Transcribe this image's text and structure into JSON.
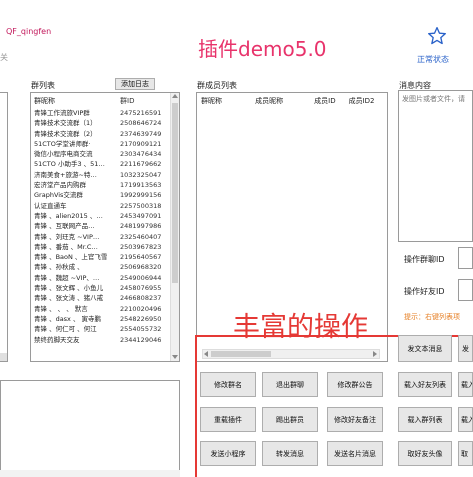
{
  "header": {
    "user_name": "QF_qingfen",
    "user_sub": "关",
    "title": "插件demo5.0",
    "status_label": "正常状态"
  },
  "groups": {
    "label": "群列表",
    "add_log_button": "添加日志",
    "col_name": "群昵称",
    "col_id": "群ID",
    "rows": [
      {
        "name": "青锋工作流旅VIP群",
        "id": "2475216591"
      },
      {
        "name": "青锋技术交流群（1）",
        "id": "2508646724"
      },
      {
        "name": "青锋技术交流群（2）",
        "id": "2374639749"
      },
      {
        "name": "51CTO学堂讲师群·",
        "id": "2170909121"
      },
      {
        "name": "微信小程序电商交流",
        "id": "2303476434"
      },
      {
        "name": "51CTO 小助手3 、51…",
        "id": "2211679662"
      },
      {
        "name": "济南美食+旅游~特…",
        "id": "1032325047"
      },
      {
        "name": "宏济堂产品内购群",
        "id": "1719913563"
      },
      {
        "name": "GraphVis交流群",
        "id": "1992999156"
      },
      {
        "name": "认证直通车",
        "id": "2257500318"
      },
      {
        "name": "青锋 、alien2015 、…",
        "id": "2453497091"
      },
      {
        "name": "青锋 、互联网产品…",
        "id": "2481997986"
      },
      {
        "name": "青锋 、刘玨克 ~VIP…",
        "id": "2325460407"
      },
      {
        "name": "青锋 、番茄 、Mr.C…",
        "id": "2503967823"
      },
      {
        "name": "青锋 、BaoN 、上官飞雪",
        "id": "2195640567"
      },
      {
        "name": "青锋 、孙秋成 、",
        "id": "2506968320"
      },
      {
        "name": "青锋 、魏超 ~VIP、…",
        "id": "2549006944"
      },
      {
        "name": "青锋 、张文辉 、小鱼儿",
        "id": "2458076955"
      },
      {
        "name": "青锋 、张文涛 、猪八戒",
        "id": "2466808237"
      },
      {
        "name": "青锋 、 、 、 默言",
        "id": "2210020496"
      },
      {
        "name": "青锋 、dasx 、 寅寺鹏",
        "id": "2548226950"
      },
      {
        "name": "青锋 、何仁可 、何江",
        "id": "2554055732"
      },
      {
        "name": "禁终药脚天交友",
        "id": "2344129046"
      }
    ]
  },
  "members": {
    "label": "群成员列表",
    "columns": [
      "群昵称",
      "成员昵称",
      "成员ID",
      "成员ID2"
    ]
  },
  "message": {
    "label": "消息内容",
    "placeholder": "发图片或者文件，请"
  },
  "fields": {
    "group_id_label": "操作群聊ID",
    "friend_id_label": "操作好友ID",
    "hint": "提示：右键列表项"
  },
  "overlay_text": "丰富的操作",
  "buttons": {
    "send_text": "发文本消息",
    "send_cut": "发",
    "edit_group_name": "修改群名",
    "leave_group": "退出群聊",
    "edit_group_notice": "修改群公告",
    "load_friend_list": "载入好友列表",
    "load_cut": "载入",
    "reload_plugin": "重载插件",
    "kick_member": "踢出群员",
    "edit_friend_note": "修改好友备注",
    "load_group_list": "载入群列表",
    "load_cut2": "载入",
    "send_mini_program": "发送小程序",
    "forward_message": "转发消息",
    "send_card": "发送名片消息",
    "get_friend_avatar": "取好友头像",
    "get_cut": "取"
  },
  "colors": {
    "title": "#e8336b",
    "overlay": "#e53935",
    "status": "#2a62c9",
    "user": "#c2185b"
  }
}
